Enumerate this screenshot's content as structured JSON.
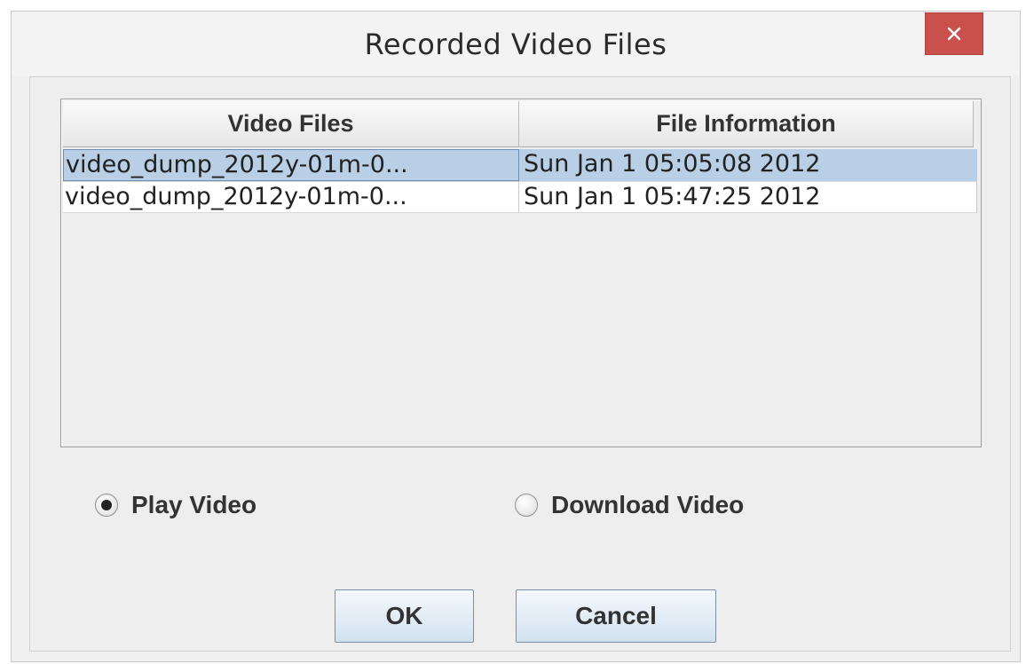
{
  "window": {
    "title": "Recorded Video Files",
    "close_icon": "close-icon"
  },
  "table": {
    "columns": [
      "Video Files",
      "File Information"
    ],
    "rows": [
      {
        "file": "video_dump_2012y-01m-0...",
        "info": "Sun Jan  1 05:05:08 2012",
        "selected": true
      },
      {
        "file": "video_dump_2012y-01m-0...",
        "info": "Sun Jan  1 05:47:25 2012",
        "selected": false
      }
    ]
  },
  "options": {
    "play_label": "Play Video",
    "download_label": "Download Video",
    "selected": "Play Video"
  },
  "buttons": {
    "ok_label": "OK",
    "cancel_label": "Cancel"
  },
  "colors": {
    "close_button": "#c9504d",
    "selected_row": "#b8cfe5",
    "button_gradient_bottom": "#d3e2f0"
  }
}
